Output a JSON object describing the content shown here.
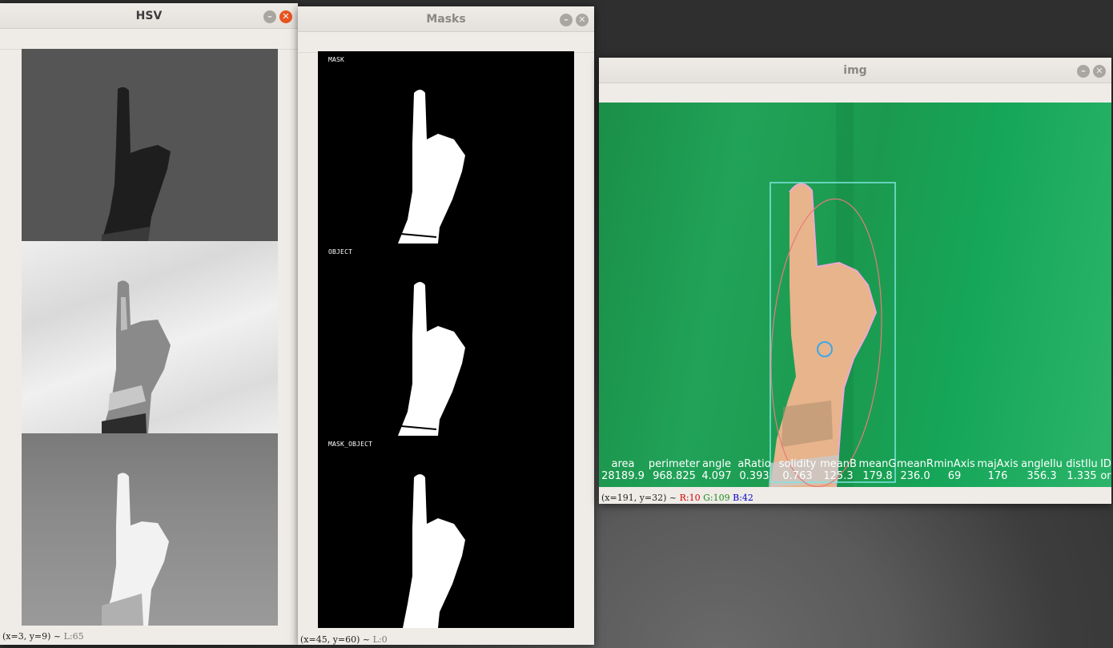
{
  "windows": {
    "hsv": {
      "title": "HSV",
      "status": {
        "coords": "(x=3, y=9) ~",
        "value": "L:65"
      }
    },
    "masks": {
      "title": "Masks",
      "labels": [
        "MASK",
        "OBJECT",
        "MASK_OBJECT"
      ],
      "status": {
        "coords": "(x=45, y=60) ~",
        "value": "L:0"
      }
    },
    "img": {
      "title": "img",
      "stats": {
        "headers": [
          "area",
          "perimeter",
          "angle",
          "aRatio",
          "solidity",
          "meanB",
          "meanG",
          "meanR",
          "minAxis",
          "majAxis",
          "angleIlu",
          "distIlu",
          "ID"
        ],
        "values": [
          "28189.9",
          "968.825",
          "4.097",
          "0.393",
          "0.763",
          "125.3",
          "179.8",
          "236.0",
          "69",
          "176",
          "356.3",
          "1.335",
          "or"
        ]
      },
      "status": {
        "coords": "(x=191, y=32) ~",
        "r": "R:10",
        "g": "G:109",
        "b": "B:42"
      }
    }
  },
  "colors": {
    "close_active": "#e95420",
    "window_bg": "#efebe7",
    "green_screen": "#1b9a4f",
    "bbox": "#7fe6e0",
    "ellipse": "#e87a7a"
  },
  "icons": [
    "minimize-icon",
    "close-icon"
  ]
}
